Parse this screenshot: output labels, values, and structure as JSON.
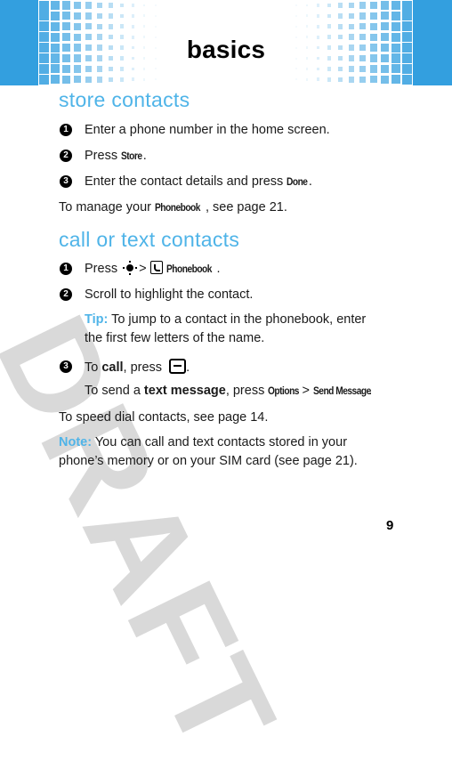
{
  "header": {
    "title": "basics",
    "band_color": "#339fdf"
  },
  "watermark": {
    "text": "DRAFT",
    "color": "#d9d9d9"
  },
  "sections": {
    "store": {
      "title": "store contacts",
      "steps": [
        {
          "number": "1",
          "text": "Enter a phone number in the home screen."
        },
        {
          "number": "2",
          "prefix": "Press ",
          "key": "Store",
          "suffix": "."
        },
        {
          "number": "3",
          "prefix": "Enter the contact details and press ",
          "key": "Done",
          "suffix": "."
        }
      ],
      "manage_note": {
        "prefix": "To manage your ",
        "key": "Phonebook",
        "suffix": ", see page 21."
      }
    },
    "call": {
      "title": "call or text contacts",
      "steps": [
        {
          "number": "1",
          "prefix": "Press ",
          "nav_icon": "nav-key-icon",
          "separator": ">",
          "menu_icon": "phonebook-icon",
          "key": "Phonebook",
          "suffix": "."
        },
        {
          "number": "2",
          "text": "Scroll to highlight the contact."
        },
        {
          "number": "3",
          "prefix": "To ",
          "bold": "call",
          "middle": ", press ",
          "icon": "send-key-icon",
          "suffix": "."
        }
      ],
      "tip": {
        "label": "Tip:",
        "line1": " To jump to a contact in the phonebook, enter",
        "line2": "the first few letters of the name."
      },
      "text_message": {
        "prefix": "To send a ",
        "bold": "text message",
        "middle": ", press ",
        "key1": "Options",
        "separator": " > ",
        "key2": "Send Message",
        "suffix": "."
      },
      "speed_dial": "To speed dial contacts, see page 14.",
      "note": {
        "label": "Note:",
        "line1": " You can call and text contacts stored in your",
        "line2": "phone’s memory or on your SIM card (see page 21)."
      }
    }
  },
  "footer": {
    "page_number": "9"
  },
  "colors": {
    "accent": "#4fb4e8",
    "header_blue": "#339fdf",
    "text": "#1a1a1a"
  }
}
